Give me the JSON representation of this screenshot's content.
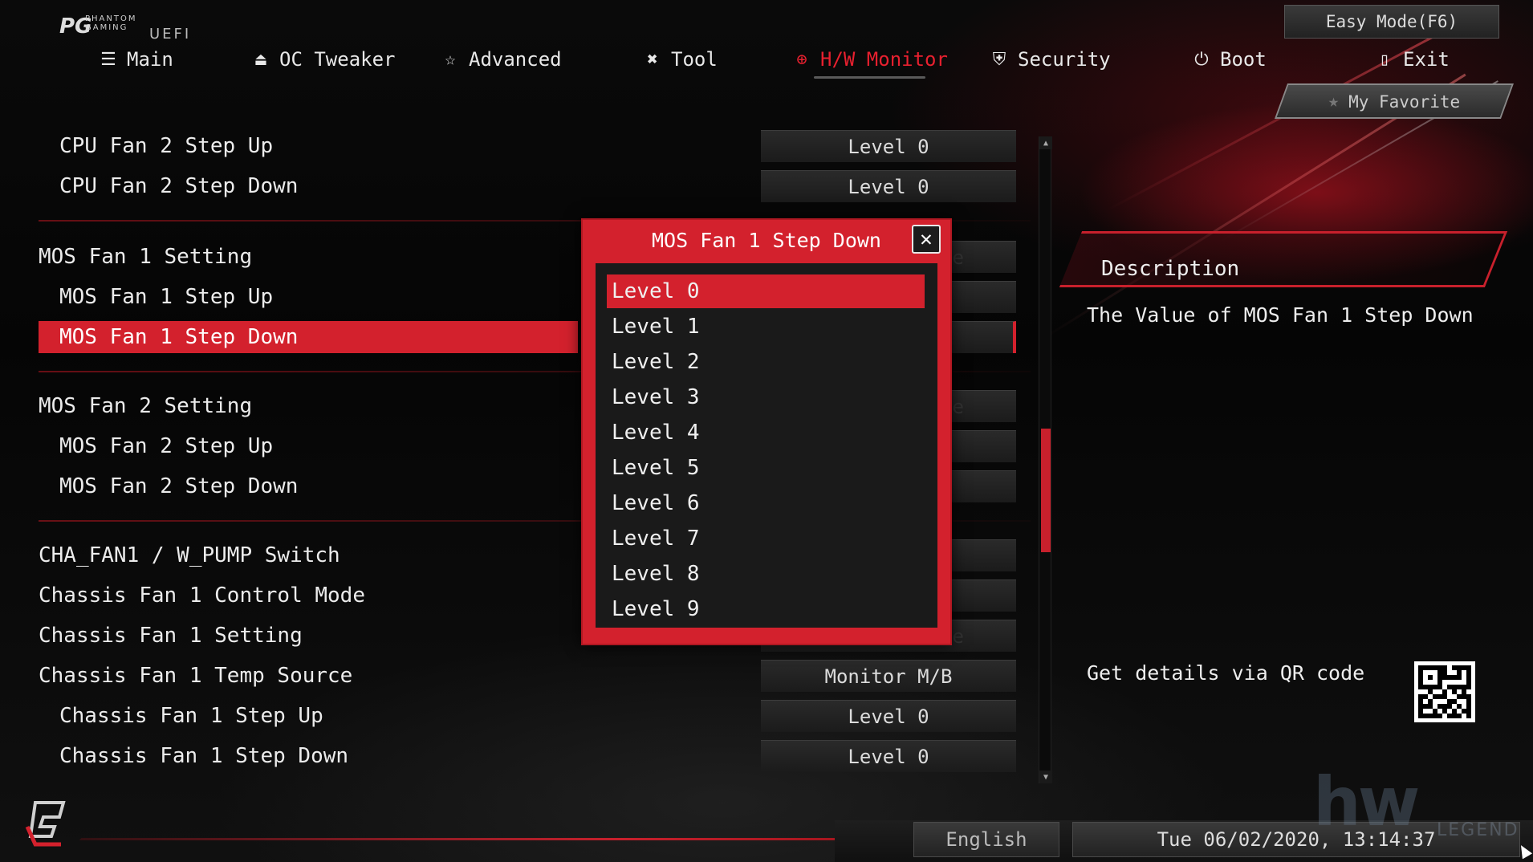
{
  "header": {
    "logo_small": "PHANTOM GAMING",
    "logo_uefi": "UEFI",
    "easy_mode": "Easy Mode(F6)",
    "my_favorite": "My Favorite"
  },
  "nav": [
    {
      "label": "Main",
      "icon": "list-icon"
    },
    {
      "label": "OC Tweaker",
      "icon": "rocket-icon"
    },
    {
      "label": "Advanced",
      "icon": "star-icon"
    },
    {
      "label": "Tool",
      "icon": "tools-icon"
    },
    {
      "label": "H/W Monitor",
      "icon": "monitor-gauge-icon",
      "active": true
    },
    {
      "label": "Security",
      "icon": "shield-icon"
    },
    {
      "label": "Boot",
      "icon": "power-icon"
    },
    {
      "label": "Exit",
      "icon": "exit-door-icon"
    }
  ],
  "settings": {
    "rows": [
      {
        "label": "CPU Fan 2 Step Up",
        "value": "Level 0"
      },
      {
        "label": "CPU Fan 2 Step Down",
        "value": "Level 0"
      },
      {
        "label": "MOS Fan 1 Setting",
        "value": "Standard Mode"
      },
      {
        "label": "MOS Fan 1 Step Up",
        "value": ""
      },
      {
        "label": "MOS Fan 1 Step Down",
        "value": ""
      },
      {
        "label": "MOS Fan 2 Setting",
        "value": "Standard Mode"
      },
      {
        "label": "MOS Fan 2 Step Up",
        "value": ""
      },
      {
        "label": "MOS Fan 2 Step Down",
        "value": ""
      },
      {
        "label": "CHA_FAN1 / W_PUMP Switch",
        "value": ""
      },
      {
        "label": "Chassis Fan 1 Control Mode",
        "value": ""
      },
      {
        "label": "Chassis Fan 1 Setting",
        "value": "Standard Mode"
      },
      {
        "label": "Chassis Fan 1 Temp Source",
        "value": "Monitor M/B"
      },
      {
        "label": "Chassis Fan 1 Step Up",
        "value": "Level 0"
      },
      {
        "label": "Chassis Fan 1 Step Down",
        "value": "Level 0"
      }
    ]
  },
  "description": {
    "title": "Description",
    "text": "The Value of MOS Fan 1 Step Down",
    "qr_text": "Get details via QR code"
  },
  "modal": {
    "title": "MOS Fan 1 Step Down",
    "options": [
      "Level 0",
      "Level 1",
      "Level 2",
      "Level 3",
      "Level 4",
      "Level 5",
      "Level 6",
      "Level 7",
      "Level 8",
      "Level 9"
    ],
    "selected": "Level 0"
  },
  "footer": {
    "language": "English",
    "datetime": "Tue 06/02/2020, 13:14:37"
  },
  "watermark": {
    "big": "hw",
    "small": "LEGEND"
  },
  "colors": {
    "accent": "#d3212d",
    "background": "#050505"
  }
}
